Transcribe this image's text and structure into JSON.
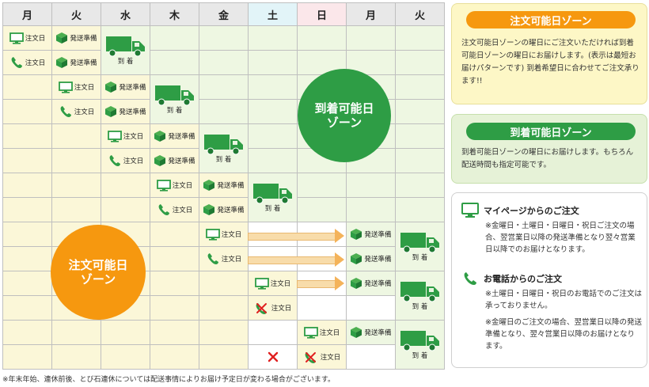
{
  "header": {
    "days": [
      "月",
      "火",
      "水",
      "木",
      "金",
      "土",
      "日",
      "月",
      "火"
    ]
  },
  "labels": {
    "order": "注文日",
    "prep": "発送準備",
    "arrive": "到 着"
  },
  "zones": {
    "green": [
      "到着可能日",
      "ゾーン"
    ],
    "orange": [
      "注文可能日",
      "ゾーン"
    ]
  },
  "panels": {
    "order_zone": {
      "title": "注文可能日ゾーン",
      "text": "注文可能日ゾーンの曜日にご注文いただければ到着可能日ゾーンの曜日にお届けします。(表示は最短お届けパターンです) 到着希望日に合わせてご注文承ります!!"
    },
    "arrival_zone": {
      "title": "到着可能日ゾーン",
      "text": "到着可能日ゾーンの曜日にお届けします。もちろん配送時間も指定可能です。"
    },
    "mypage": {
      "title": "マイページからのご注文",
      "text": "※金曜日・土曜日・日曜日・祝日ご注文の場合、翌営業日以降の発送準備となり翌々営業日以降でのお届けとなります。"
    },
    "phone": {
      "title": "お電話からのご注文",
      "text1": "※土曜日・日曜日・祝日のお電話でのご注文は承っておりません。",
      "text2": "※金曜日のご注文の場合、翌営業日以降の発送準備となり、翌々営業日以降のお届けとなります。"
    }
  },
  "footnote": "※年末年始、連休前後、とび石連休については配送事情によりお届け予定日が変わる場合がございます。",
  "colors": {
    "green": "#2e9d45",
    "orange": "#f6980f",
    "order_panel_bg": "#fdf7c6",
    "arrival_panel_bg": "#e6f2d7"
  },
  "icons": [
    "monitor-icon",
    "phone-icon",
    "box-icon",
    "truck-icon",
    "cross-icon",
    "phone-cross-icon",
    "arrow-icon"
  ]
}
